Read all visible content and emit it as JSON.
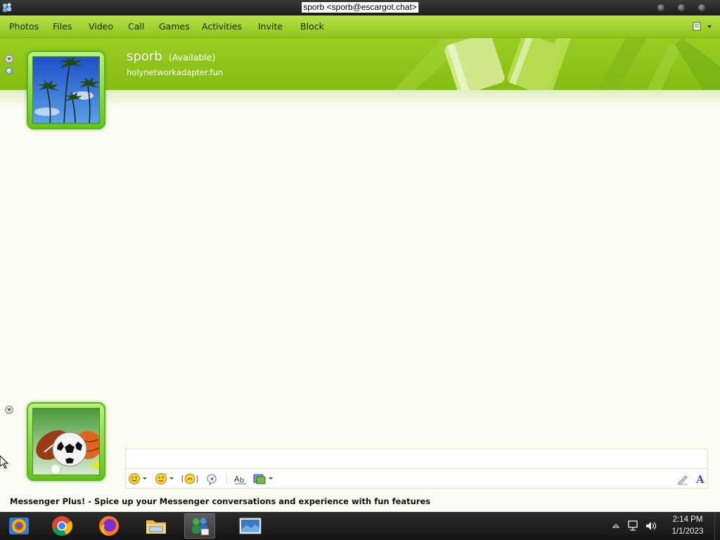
{
  "window": {
    "title": "sporb <sporb@escargot.chat>"
  },
  "menu": {
    "items": [
      "Photos",
      "Files",
      "Video",
      "Call",
      "Games",
      "Activities",
      "Invite",
      "Block"
    ],
    "options_icon": "options-icon"
  },
  "contact": {
    "name": "sporb",
    "status": "(Available)",
    "personal_message": "holynetworkadapter.fun",
    "avatar": "palm-trees"
  },
  "self": {
    "avatar": "sports-balls"
  },
  "compose": {
    "value": "",
    "toolbar": [
      "emoticon-icon",
      "wink-icon",
      "nudge-icon",
      "voice-clip-icon",
      "font-icon",
      "background-icon",
      "handwriting-icon",
      "text-format-icon"
    ]
  },
  "status_bar": {
    "text": "Messenger Plus! - Spice up your Messenger conversations and experience with fun features"
  },
  "taskbar": {
    "apps": [
      "chrome-canary-icon",
      "chrome-icon",
      "firefox-icon",
      "file-explorer-icon",
      "messenger-icon",
      "photo-viewer-icon"
    ],
    "time": "2:14 PM",
    "date": "1/1/2023"
  },
  "colors": {
    "accent": "#8fc51c",
    "header": "#92c81c",
    "taskbar": "#1e1e1e"
  }
}
